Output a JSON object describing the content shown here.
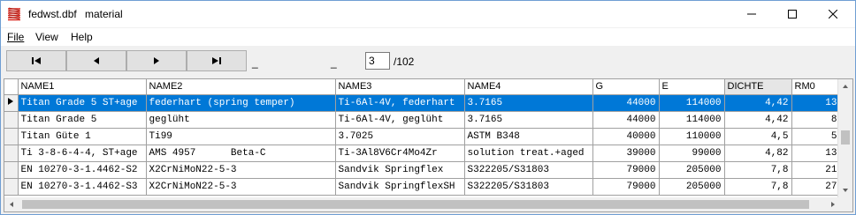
{
  "window": {
    "file_name": "fedwst.dbf",
    "table_name": "material",
    "icon": "app-coil-icon"
  },
  "menu": [
    "File",
    "View",
    "Help"
  ],
  "toolbar": {
    "first_icon": "first-record-icon",
    "prev_icon": "prev-record-icon",
    "next_icon": "next-record-icon",
    "last_icon": "last-record-icon",
    "dash1": "_",
    "dash2": "_",
    "page_value": "3",
    "page_total": "/102"
  },
  "grid": {
    "columns": [
      "NAME1",
      "NAME2",
      "NAME3",
      "NAME4",
      "G",
      "E",
      "DICHTE",
      "RM0"
    ],
    "rows": [
      [
        "Titan Grade 5 ST+age",
        "federhart (spring temper)",
        "Ti-6Al-4V, federhart",
        "3.7165",
        "44000",
        "114000",
        "4,42",
        "13"
      ],
      [
        "Titan Grade 5",
        "geglüht",
        "Ti-6Al-4V, geglüht",
        "3.7165",
        "44000",
        "114000",
        "4,42",
        "8"
      ],
      [
        "Titan Güte 1",
        "Ti99",
        "3.7025",
        "ASTM B348",
        "40000",
        "110000",
        "4,5",
        "5"
      ],
      [
        "Ti 3-8-6-4-4, ST+age",
        "AMS 4957      Beta-C",
        "Ti-3Al8V6Cr4Mo4Zr",
        "solution treat.+aged",
        "39000",
        "99000",
        "4,82",
        "13"
      ],
      [
        "EN 10270-3-1.4462-S2",
        "X2CrNiMoN22-5-3",
        "Sandvik Springflex",
        "S322205/S31803",
        "79000",
        "205000",
        "7,8",
        "21"
      ],
      [
        "EN 10270-3-1.4462-S3",
        "X2CrNiMoN22-5-3",
        "Sandvik SpringflexSH",
        "S322205/S31803",
        "79000",
        "205000",
        "7,8",
        "27"
      ]
    ],
    "selected_row": 0,
    "sorted_column": "DICHTE"
  },
  "colors": {
    "selection": "#0078d7",
    "window_border": "#6f9ed3"
  }
}
